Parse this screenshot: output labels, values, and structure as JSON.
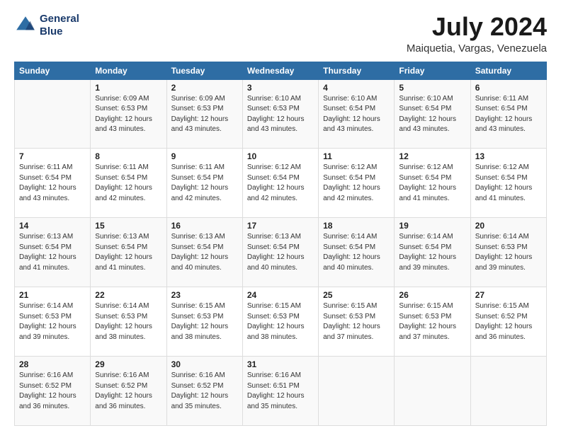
{
  "logo": {
    "line1": "General",
    "line2": "Blue"
  },
  "title": "July 2024",
  "location": "Maiquetia, Vargas, Venezuela",
  "weekdays": [
    "Sunday",
    "Monday",
    "Tuesday",
    "Wednesday",
    "Thursday",
    "Friday",
    "Saturday"
  ],
  "weeks": [
    [
      {
        "day": "",
        "info": ""
      },
      {
        "day": "1",
        "info": "Sunrise: 6:09 AM\nSunset: 6:53 PM\nDaylight: 12 hours\nand 43 minutes."
      },
      {
        "day": "2",
        "info": "Sunrise: 6:09 AM\nSunset: 6:53 PM\nDaylight: 12 hours\nand 43 minutes."
      },
      {
        "day": "3",
        "info": "Sunrise: 6:10 AM\nSunset: 6:53 PM\nDaylight: 12 hours\nand 43 minutes."
      },
      {
        "day": "4",
        "info": "Sunrise: 6:10 AM\nSunset: 6:54 PM\nDaylight: 12 hours\nand 43 minutes."
      },
      {
        "day": "5",
        "info": "Sunrise: 6:10 AM\nSunset: 6:54 PM\nDaylight: 12 hours\nand 43 minutes."
      },
      {
        "day": "6",
        "info": "Sunrise: 6:11 AM\nSunset: 6:54 PM\nDaylight: 12 hours\nand 43 minutes."
      }
    ],
    [
      {
        "day": "7",
        "info": ""
      },
      {
        "day": "8",
        "info": "Sunrise: 6:11 AM\nSunset: 6:54 PM\nDaylight: 12 hours\nand 42 minutes."
      },
      {
        "day": "9",
        "info": "Sunrise: 6:11 AM\nSunset: 6:54 PM\nDaylight: 12 hours\nand 42 minutes."
      },
      {
        "day": "10",
        "info": "Sunrise: 6:12 AM\nSunset: 6:54 PM\nDaylight: 12 hours\nand 42 minutes."
      },
      {
        "day": "11",
        "info": "Sunrise: 6:12 AM\nSunset: 6:54 PM\nDaylight: 12 hours\nand 42 minutes."
      },
      {
        "day": "12",
        "info": "Sunrise: 6:12 AM\nSunset: 6:54 PM\nDaylight: 12 hours\nand 41 minutes."
      },
      {
        "day": "13",
        "info": "Sunrise: 6:12 AM\nSunset: 6:54 PM\nDaylight: 12 hours\nand 41 minutes."
      }
    ],
    [
      {
        "day": "14",
        "info": ""
      },
      {
        "day": "15",
        "info": "Sunrise: 6:13 AM\nSunset: 6:54 PM\nDaylight: 12 hours\nand 41 minutes."
      },
      {
        "day": "16",
        "info": "Sunrise: 6:13 AM\nSunset: 6:54 PM\nDaylight: 12 hours\nand 40 minutes."
      },
      {
        "day": "17",
        "info": "Sunrise: 6:13 AM\nSunset: 6:54 PM\nDaylight: 12 hours\nand 40 minutes."
      },
      {
        "day": "18",
        "info": "Sunrise: 6:14 AM\nSunset: 6:54 PM\nDaylight: 12 hours\nand 40 minutes."
      },
      {
        "day": "19",
        "info": "Sunrise: 6:14 AM\nSunset: 6:54 PM\nDaylight: 12 hours\nand 39 minutes."
      },
      {
        "day": "20",
        "info": "Sunrise: 6:14 AM\nSunset: 6:53 PM\nDaylight: 12 hours\nand 39 minutes."
      }
    ],
    [
      {
        "day": "21",
        "info": ""
      },
      {
        "day": "22",
        "info": "Sunrise: 6:14 AM\nSunset: 6:53 PM\nDaylight: 12 hours\nand 38 minutes."
      },
      {
        "day": "23",
        "info": "Sunrise: 6:15 AM\nSunset: 6:53 PM\nDaylight: 12 hours\nand 38 minutes."
      },
      {
        "day": "24",
        "info": "Sunrise: 6:15 AM\nSunset: 6:53 PM\nDaylight: 12 hours\nand 38 minutes."
      },
      {
        "day": "25",
        "info": "Sunrise: 6:15 AM\nSunset: 6:53 PM\nDaylight: 12 hours\nand 37 minutes."
      },
      {
        "day": "26",
        "info": "Sunrise: 6:15 AM\nSunset: 6:53 PM\nDaylight: 12 hours\nand 37 minutes."
      },
      {
        "day": "27",
        "info": "Sunrise: 6:15 AM\nSunset: 6:52 PM\nDaylight: 12 hours\nand 36 minutes."
      }
    ],
    [
      {
        "day": "28",
        "info": "Sunrise: 6:16 AM\nSunset: 6:52 PM\nDaylight: 12 hours\nand 36 minutes."
      },
      {
        "day": "29",
        "info": "Sunrise: 6:16 AM\nSunset: 6:52 PM\nDaylight: 12 hours\nand 36 minutes."
      },
      {
        "day": "30",
        "info": "Sunrise: 6:16 AM\nSunset: 6:52 PM\nDaylight: 12 hours\nand 35 minutes."
      },
      {
        "day": "31",
        "info": "Sunrise: 6:16 AM\nSunset: 6:51 PM\nDaylight: 12 hours\nand 35 minutes."
      },
      {
        "day": "",
        "info": ""
      },
      {
        "day": "",
        "info": ""
      },
      {
        "day": "",
        "info": ""
      }
    ]
  ]
}
